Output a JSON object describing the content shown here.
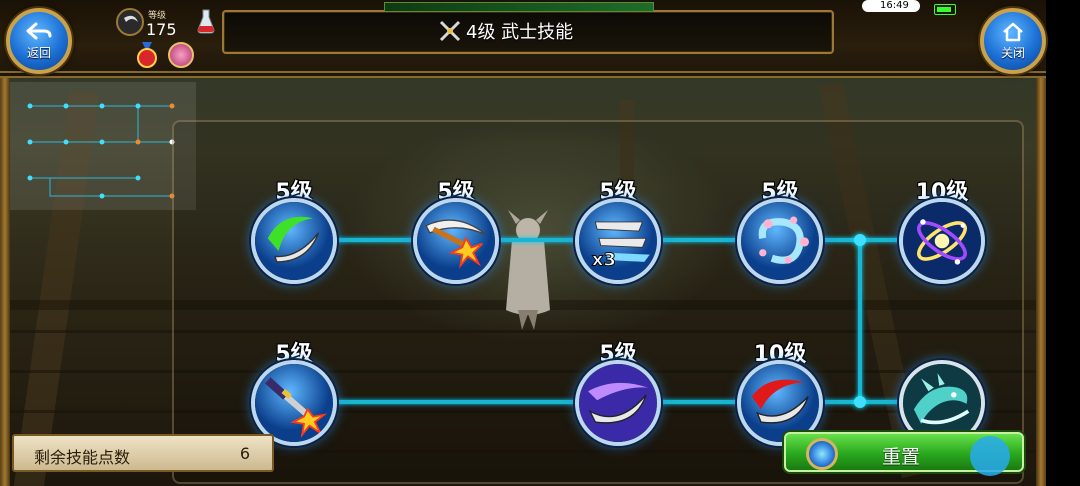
{
  "header": {
    "back_label": "返回",
    "close_label": "关闭",
    "level_caption": "等级",
    "level_value": "175",
    "title": "4级 武士技能",
    "clock": "16:49"
  },
  "skills": {
    "row1": [
      {
        "level": "5级",
        "icon": "green-crescent-slash-icon"
      },
      {
        "level": "5级",
        "icon": "blade-explosion-icon"
      },
      {
        "level": "5级",
        "icon": "triple-slash-x3-icon"
      },
      {
        "level": "5级",
        "icon": "petal-whirl-icon"
      },
      {
        "level": "10级",
        "icon": "orbit-sparkle-icon"
      }
    ],
    "row2": [
      {
        "level": "5级",
        "icon": "katana-burst-icon"
      },
      {
        "level": "5级",
        "icon": "purple-crescent-slash-icon"
      },
      {
        "level": "10级",
        "icon": "red-crescent-slash-icon"
      },
      {
        "level": "",
        "icon": "dragon-wave-icon"
      }
    ],
    "x3_badge": "x3"
  },
  "footer": {
    "points_label": "剩余技能点数",
    "points_value": "6",
    "reset_label": "重置"
  },
  "colors": {
    "connector": "#18b6d0",
    "reset_green": "#2aa81e",
    "frame_gold": "#c9a24a"
  }
}
